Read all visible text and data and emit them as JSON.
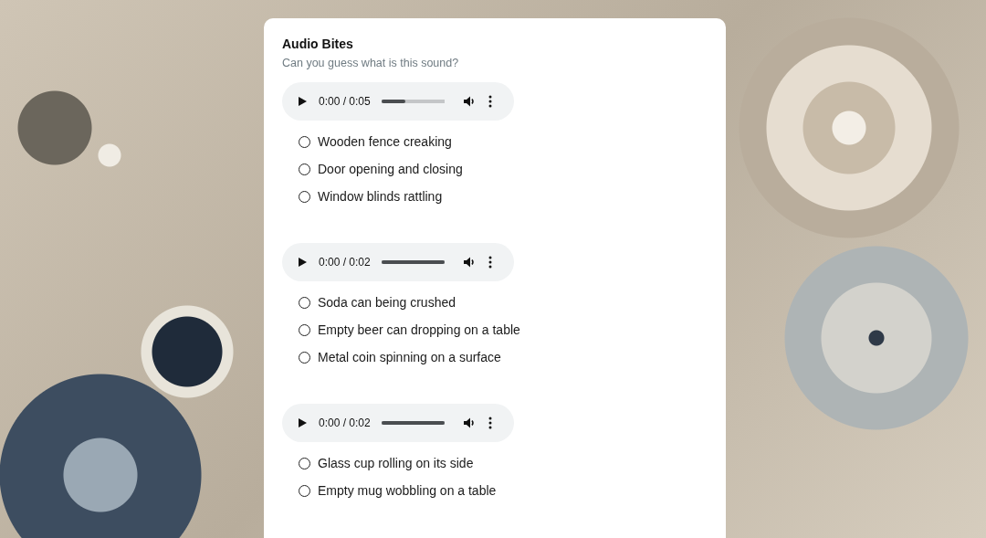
{
  "card": {
    "title": "Audio Bites",
    "subtitle": "Can you guess what is this sound?"
  },
  "questions": [
    {
      "player": {
        "time": "0:00 / 0:05",
        "level": 0.38
      },
      "options": [
        {
          "label": "Wooden fence creaking",
          "selected": false
        },
        {
          "label": "Door opening and closing",
          "selected": false
        },
        {
          "label": "Window blinds rattling",
          "selected": false
        }
      ]
    },
    {
      "player": {
        "time": "0:00 / 0:02",
        "level": 1
      },
      "options": [
        {
          "label": "Soda can being crushed",
          "selected": false
        },
        {
          "label": "Empty beer can dropping on a table",
          "selected": false
        },
        {
          "label": "Metal coin spinning on a surface",
          "selected": false
        }
      ]
    },
    {
      "player": {
        "time": "0:00 / 0:02",
        "level": 1
      },
      "options": [
        {
          "label": "Glass cup rolling on its side",
          "selected": false
        },
        {
          "label": "Empty mug wobbling on a table",
          "selected": false
        }
      ]
    }
  ]
}
